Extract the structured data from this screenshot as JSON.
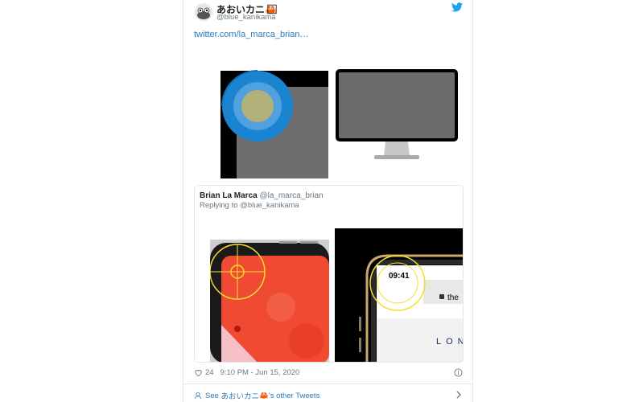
{
  "author": {
    "display_name": "あおいカニ",
    "emoji": "🦀",
    "trailing_glyph": "⃞",
    "handle": "@blue_kanikama"
  },
  "link_text": "twitter.com/la_marca_brian…",
  "quoted_tweet": {
    "name": "Brian La Marca",
    "handle": "@la_marca_brian",
    "replying_prefix": "Replying to",
    "replying_to": "@blue_kanikama",
    "clock_time": "09:41",
    "url_bar_text": "the",
    "site_text": "LON"
  },
  "footer": {
    "likes": "24",
    "timestamp": "9:10 PM - Jun 15, 2020",
    "see_more_prefix": "See",
    "see_more_name": "あおいカニ",
    "see_more_suffix": "'s other Tweets"
  },
  "colors": {
    "link": "#2b7bb9",
    "twitter_blue": "#1da1f2",
    "secondary_text": "#697882",
    "ring_blue": "#1b84d1",
    "inner_circle": "#b0b07a",
    "guide_yellow": "#f3de2c",
    "red_screen": "#f04a32"
  }
}
